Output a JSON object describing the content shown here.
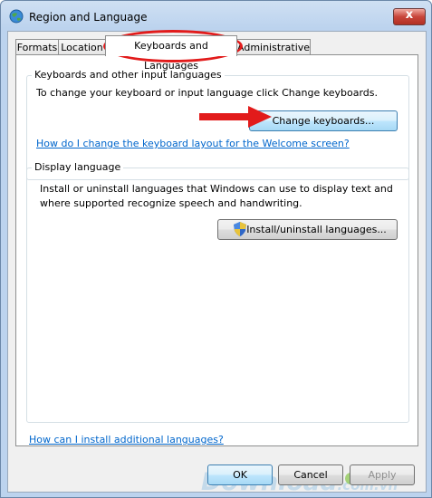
{
  "window": {
    "title": "Region and Language",
    "close_glyph": "x"
  },
  "tabs": [
    {
      "label": "Formats"
    },
    {
      "label": "Location"
    },
    {
      "label": "Keyboards and Languages"
    },
    {
      "label": "Administrative"
    }
  ],
  "keyboards_group": {
    "title": "Keyboards and other input languages",
    "description": "To change your keyboard or input language click Change keyboards.",
    "change_button": "Change keyboards...",
    "help_link": "How do I change the keyboard layout for the Welcome screen?"
  },
  "display_group": {
    "title": "Display language",
    "description_line1": "Install or uninstall languages that Windows can use to display text and",
    "description_line2": "where supported recognize speech and handwriting.",
    "install_button": "Install/uninstall languages..."
  },
  "footer_link": "How can I install additional languages?",
  "buttons": {
    "ok": "OK",
    "cancel": "Cancel",
    "apply": "Apply"
  },
  "watermark": {
    "main": "Download",
    "suffix": ".com.vn"
  },
  "colors": {
    "highlight": "#e21b1b",
    "link": "#0066cc"
  }
}
